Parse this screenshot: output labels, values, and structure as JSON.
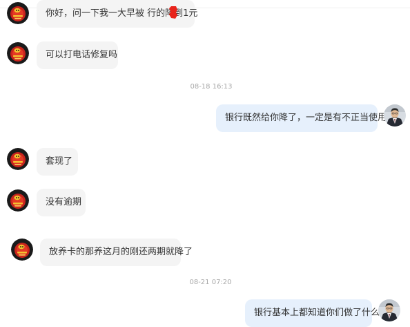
{
  "icons": {
    "contact_avatar": "contact-avatar-icon",
    "user_avatar": "user-avatar-icon"
  },
  "colors": {
    "incoming_bubble": "#f4f4f4",
    "outgoing_bubble": "#e6f0fc",
    "timestamp_text": "#a8a8a8",
    "redaction_mark": "#e8231a"
  },
  "messages": [
    {
      "id": "m1",
      "sender": "contact",
      "text": "你好，问一下我一大早被    行的降到1元"
    },
    {
      "id": "m2",
      "sender": "contact",
      "text": "可以打电话修复吗"
    },
    {
      "id": "t1",
      "type": "timestamp",
      "text": "08-18 16:13"
    },
    {
      "id": "m3",
      "sender": "user",
      "text": "银行既然给你降了，一定是有不正当使用"
    },
    {
      "id": "m4",
      "sender": "contact",
      "text": "套现了"
    },
    {
      "id": "m5",
      "sender": "contact",
      "text": "没有逾期"
    },
    {
      "id": "m6",
      "sender": "contact",
      "text": "放养卡的那养这月的刚还两期就降了"
    },
    {
      "id": "t2",
      "type": "timestamp",
      "text": "08-21 07:20"
    },
    {
      "id": "m7",
      "sender": "user",
      "text": "银行基本上都知道你们做了什么"
    }
  ]
}
